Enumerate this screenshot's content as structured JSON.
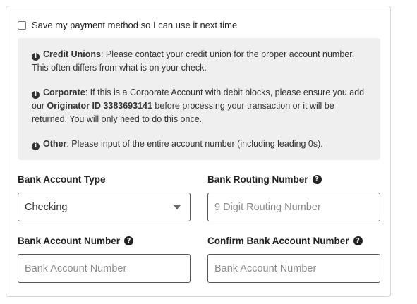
{
  "save_payment": {
    "label": "Save my payment method so I can use it next time",
    "checked": false
  },
  "notices": {
    "credit_unions": {
      "title": "Credit Unions",
      "text": ": Please contact your credit union for the proper account number. This often differs from what is on your check."
    },
    "corporate": {
      "title": "Corporate",
      "text_before": ": If this is a Corporate Account with debit blocks, please ensure you add our ",
      "originator": "Originator ID 3383693141",
      "text_after": " before processing your transaction or it will be returned. You will only need to do this once."
    },
    "other": {
      "title": "Other",
      "text": ": Please input of the entire account number (including leading 0s)."
    }
  },
  "fields": {
    "account_type": {
      "label": "Bank Account Type",
      "value": "Checking"
    },
    "routing_number": {
      "label": "Bank Routing Number",
      "placeholder": "9 Digit Routing Number"
    },
    "account_number": {
      "label": "Bank Account Number",
      "placeholder": "Bank Account Number"
    },
    "confirm_account_number": {
      "label": "Confirm Bank Account Number",
      "placeholder": "Bank Account Number"
    }
  },
  "icons": {
    "info": "info-circle-icon",
    "help": "question-circle-icon"
  }
}
